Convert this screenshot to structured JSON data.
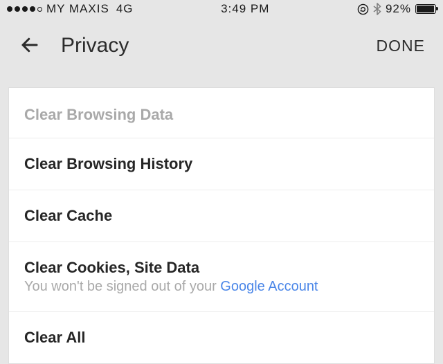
{
  "status_bar": {
    "carrier": "MY MAXIS",
    "network_type": "4G",
    "time": "3:49 PM",
    "battery_percent": "92%",
    "battery_fill_pct": 92
  },
  "header": {
    "title": "Privacy",
    "done_label": "DONE"
  },
  "section": {
    "header": "Clear Browsing Data",
    "items": [
      {
        "label": "Clear Browsing History"
      },
      {
        "label": "Clear Cache"
      },
      {
        "label": "Clear Cookies, Site Data",
        "subtext_prefix": "You won't be signed out of your ",
        "subtext_link": "Google Account"
      },
      {
        "label": "Clear All"
      }
    ]
  }
}
